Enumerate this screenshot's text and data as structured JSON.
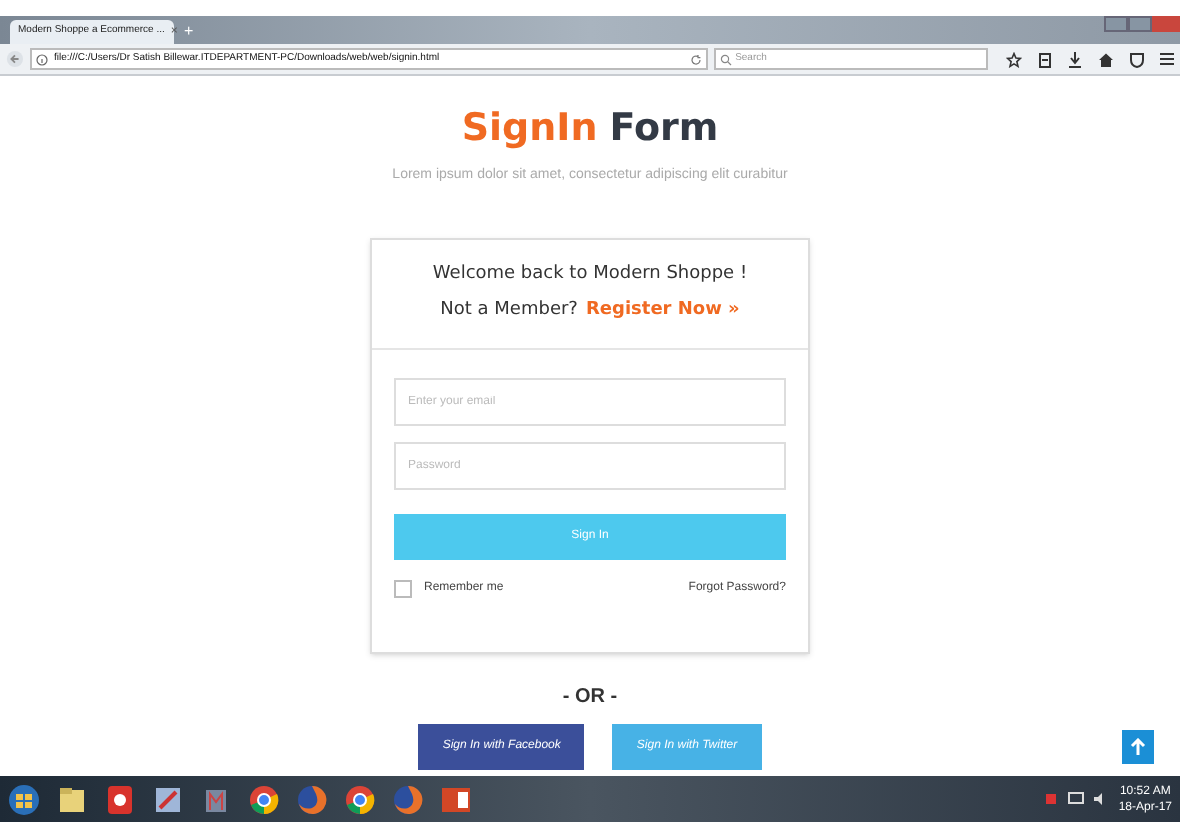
{
  "browser": {
    "tab_title": "Modern Shoppe a Ecommerce ...",
    "tab_close": "×",
    "new_tab": "+",
    "url": "file:///C:/Users/Dr Satish Billewar.ITDEPARTMENT-PC/Downloads/web/web/signin.html",
    "search_placeholder": "Search"
  },
  "heading": {
    "highlight": "SignIn",
    "rest": "Form"
  },
  "subtitle": "Lorem ipsum dolor sit amet, consectetur adipiscing elit curabitur",
  "card": {
    "welcome": "Welcome back to Modern Shoppe !",
    "member_prompt": "Not a Member?",
    "register_link": "Register Now »",
    "email": {
      "placeholder": "Enter your email"
    },
    "password": {
      "placeholder": "Password"
    },
    "submit": "Sign In",
    "remember": {
      "label": "Remember me",
      "checked": false
    },
    "forgot": "Forgot Password?"
  },
  "or_label": "- OR -",
  "social_buttons": [
    {
      "label": "Sign In with Facebook",
      "color": "#3b4f9a"
    },
    {
      "label": "Sign In with Twitter",
      "color": "#47b2e6"
    }
  ],
  "taskbar": {
    "apps": [
      {
        "kind": "start"
      },
      {
        "kind": "folder"
      },
      {
        "kind": "red"
      },
      {
        "kind": "blue"
      },
      {
        "kind": "tool"
      },
      {
        "kind": "chrome"
      },
      {
        "kind": "firefox"
      },
      {
        "kind": "chrome"
      },
      {
        "kind": "firefox"
      },
      {
        "kind": "powerpoint"
      }
    ],
    "time": "10:52 AM",
    "date": "18-Apr-17"
  }
}
